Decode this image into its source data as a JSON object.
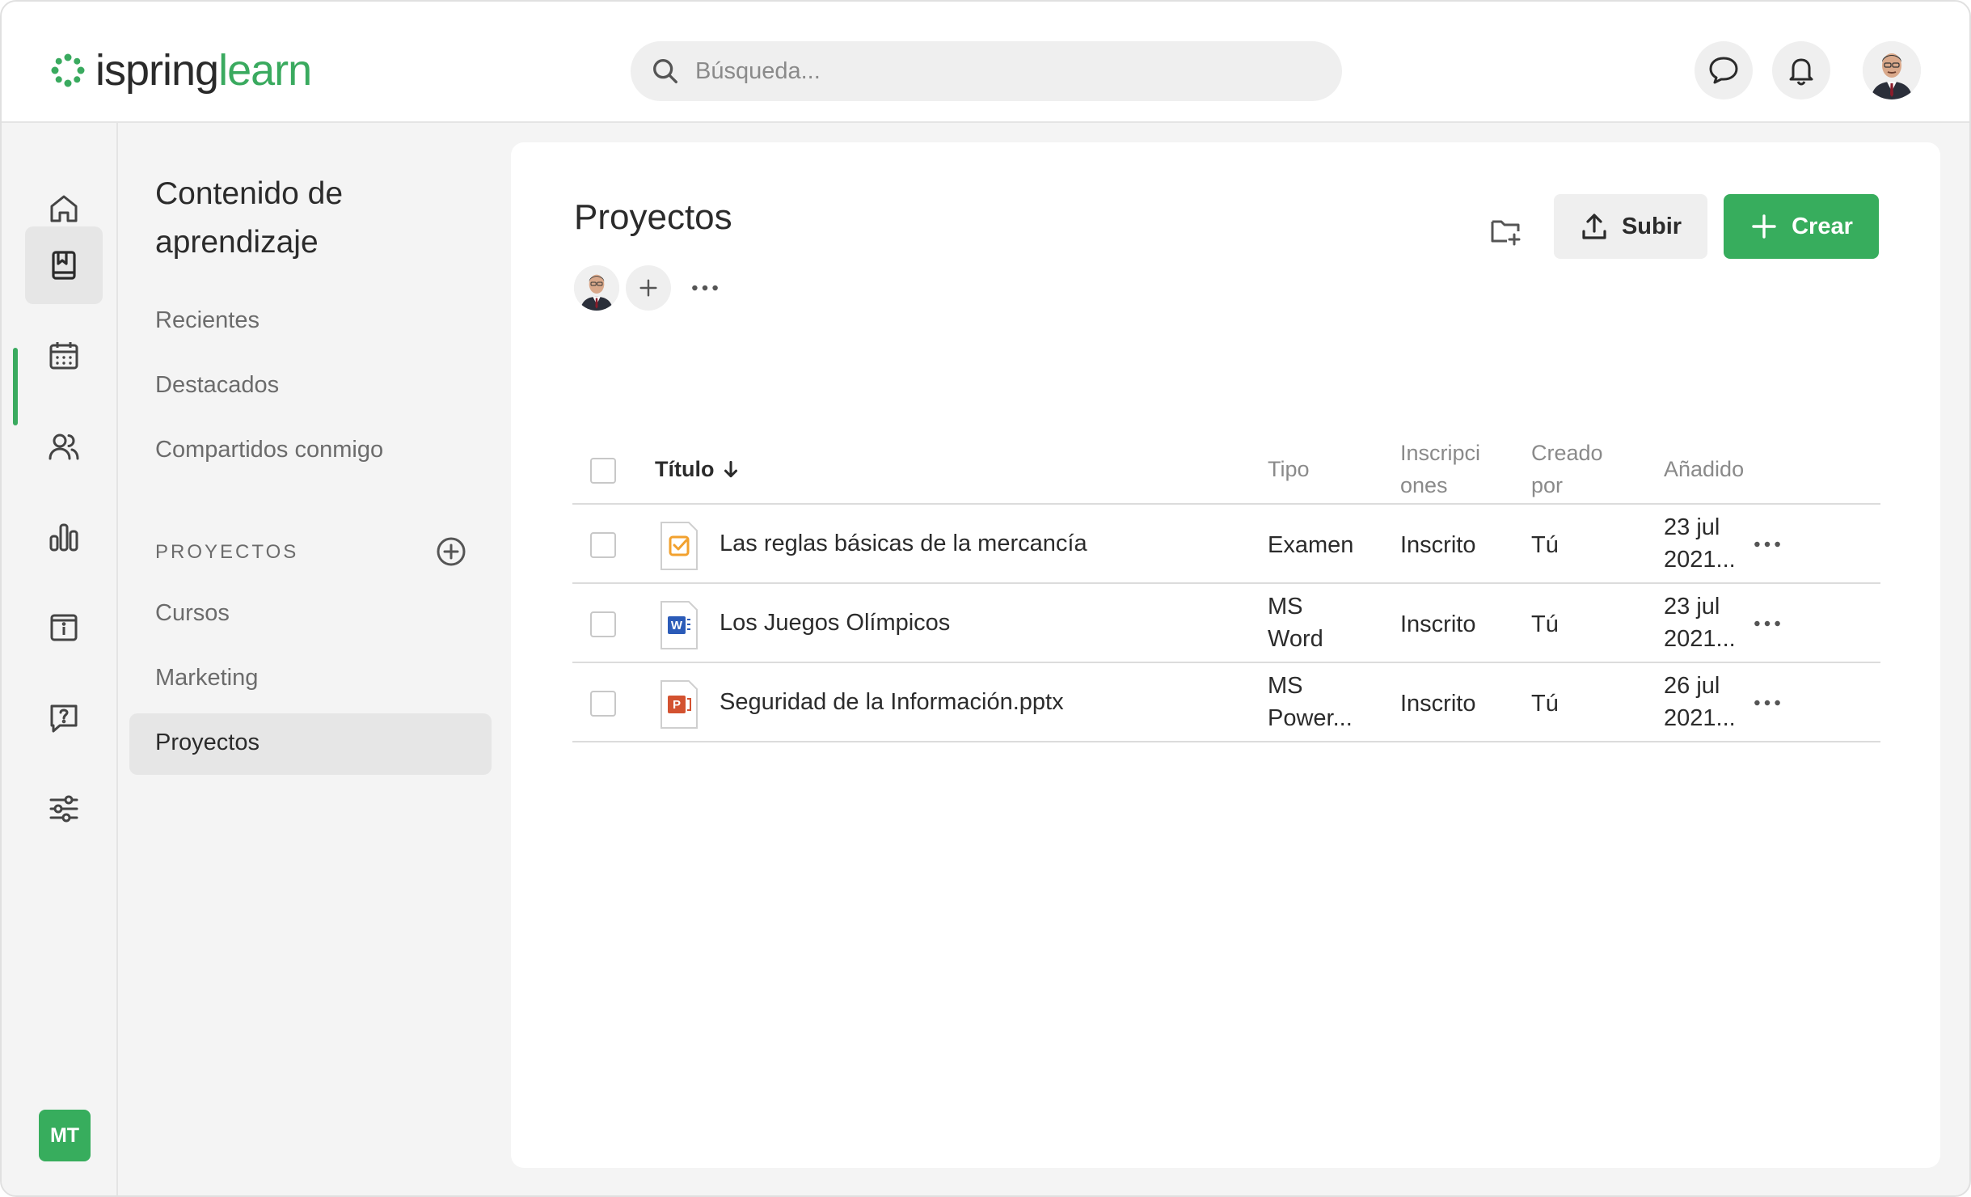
{
  "app": {
    "logo_part1": "ispring",
    "logo_part2": "learn"
  },
  "search": {
    "placeholder": "Búsqueda..."
  },
  "rail": {
    "items": [
      "home-icon",
      "book-icon",
      "calendar-icon",
      "users-icon",
      "chart-icon",
      "info-icon",
      "question-icon",
      "settings-icon"
    ],
    "active_index": 1,
    "user_initials": "MT"
  },
  "subnav": {
    "title": "Contenido de aprendizaje",
    "links": [
      "Recientes",
      "Destacados",
      "Compartidos conmigo"
    ],
    "section_label": "PROYECTOS",
    "section_items": [
      "Cursos",
      "Marketing",
      "Proyectos"
    ],
    "active_item": "Proyectos"
  },
  "main": {
    "title": "Proyectos",
    "upload_label": "Subir",
    "create_label": "Crear"
  },
  "table": {
    "headers": {
      "title": "Título",
      "type": "Tipo",
      "enrollments_line1": "Inscripci",
      "enrollments_line2": "ones",
      "created_by_line1": "Creado",
      "created_by_line2": "por",
      "added": "Añadido"
    },
    "rows": [
      {
        "icon": "quiz-icon",
        "title": "Las reglas básicas de la mercancía",
        "type_line1": "Examen",
        "type_line2": "",
        "enrollment": "Inscrito",
        "created_by": "Tú",
        "added_line1": "23 jul",
        "added_line2": "2021..."
      },
      {
        "icon": "word-doc-icon",
        "title": "Los Juegos Olímpicos",
        "type_line1": "MS",
        "type_line2": "Word",
        "enrollment": "Inscrito",
        "created_by": "Tú",
        "added_line1": "23 jul",
        "added_line2": "2021..."
      },
      {
        "icon": "powerpoint-doc-icon",
        "title": "Seguridad de la Información.pptx",
        "type_line1": "MS",
        "type_line2": "Power...",
        "enrollment": "Inscrito",
        "created_by": "Tú",
        "added_line1": "26 jul",
        "added_line2": "2021..."
      }
    ]
  },
  "colors": {
    "brand_green": "#37ad5d",
    "quiz_orange": "#f2a12e",
    "word_blue": "#2b5bb8",
    "powerpoint_red": "#d35230"
  }
}
